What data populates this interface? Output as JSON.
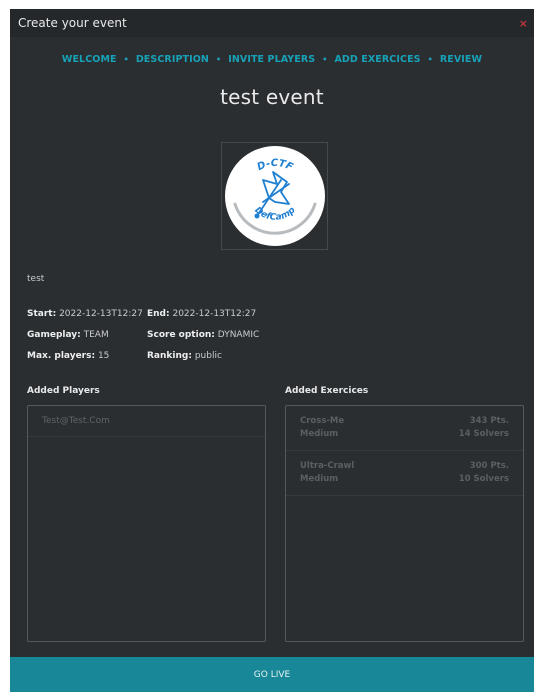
{
  "window": {
    "title": "Create your event",
    "close_glyph": "×"
  },
  "steps": [
    {
      "label": "WELCOME"
    },
    {
      "label": "DESCRIPTION"
    },
    {
      "label": "INVITE PLAYERS"
    },
    {
      "label": "ADD EXERCICES"
    },
    {
      "label": "REVIEW"
    }
  ],
  "step_separator": "•",
  "event": {
    "title": "test event",
    "description": "test",
    "logo": {
      "top_text": "D-CTF",
      "bottom_text": "DefCamp",
      "icon": "flag-icon"
    }
  },
  "details": {
    "start_label": "Start:",
    "start_value": "2022-12-13T12:27",
    "end_label": "End:",
    "end_value": "2022-12-13T12:27",
    "gameplay_label": "Gameplay:",
    "gameplay_value": "TEAM",
    "score_label": "Score option:",
    "score_value": "DYNAMIC",
    "max_players_label": "Max. players:",
    "max_players_value": "15",
    "ranking_label": "Ranking:",
    "ranking_value": "public"
  },
  "players": {
    "label": "Added Players",
    "items": [
      {
        "email": "Test@Test.Com"
      }
    ]
  },
  "exercises": {
    "label": "Added Exercices",
    "items": [
      {
        "name": "Cross-Me",
        "points": "343 Pts.",
        "difficulty": "Medium",
        "solvers": "14 Solvers"
      },
      {
        "name": "Ultra-Crawl",
        "points": "300 Pts.",
        "difficulty": "Medium",
        "solvers": "10 Solvers"
      }
    ]
  },
  "actions": {
    "go_live": "GO LIVE"
  },
  "colors": {
    "accent": "#17a2b8",
    "button": "#188797",
    "background": "#2b2e31",
    "close": "#c0343f",
    "logo_blue": "#1f7fd1"
  }
}
